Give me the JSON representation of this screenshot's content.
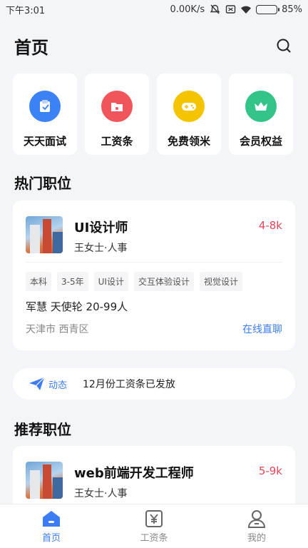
{
  "status_bar": {
    "time": "下午3:01",
    "speed": "0.00K/s",
    "battery": "85%",
    "battery_level": 0.85
  },
  "header": {
    "title": "首页",
    "search_icon": "search-icon"
  },
  "quick_actions": [
    {
      "label": "天天面试",
      "icon": "interview-icon",
      "color": "#3b82f6"
    },
    {
      "label": "工资条",
      "icon": "folder-icon",
      "color": "#f0555b"
    },
    {
      "label": "免费领米",
      "icon": "gamepad-icon",
      "color": "#f5c400"
    },
    {
      "label": "会员权益",
      "icon": "crown-icon",
      "color": "#33c48a"
    }
  ],
  "hot_jobs": {
    "section_title": "热门职位",
    "job": {
      "title": "UI设计师",
      "salary": "4-8k",
      "contact": "王女士·人事",
      "tags": [
        "本科",
        "3-5年",
        "UI设计",
        "交互体验设计",
        "视觉设计"
      ],
      "company": "军慧 天使轮 20-99人",
      "location": "天津市 西青区",
      "chat_label": "在线直聊"
    }
  },
  "news": {
    "tag_label": "动态",
    "text": "12月份工资条已发放"
  },
  "recommended_jobs": {
    "section_title": "推荐职位",
    "job": {
      "title": "web前端开发工程师",
      "salary": "5-9k",
      "contact": "王女士·人事"
    }
  },
  "tabbar": {
    "items": [
      {
        "label": "首页",
        "icon": "home-icon",
        "active": true
      },
      {
        "label": "工资条",
        "icon": "yen-icon",
        "active": false
      },
      {
        "label": "我的",
        "icon": "user-icon",
        "active": false
      }
    ]
  },
  "colors": {
    "accent": "#3b7cf4",
    "salary": "#e5455a",
    "background": "#f4f5f9"
  }
}
